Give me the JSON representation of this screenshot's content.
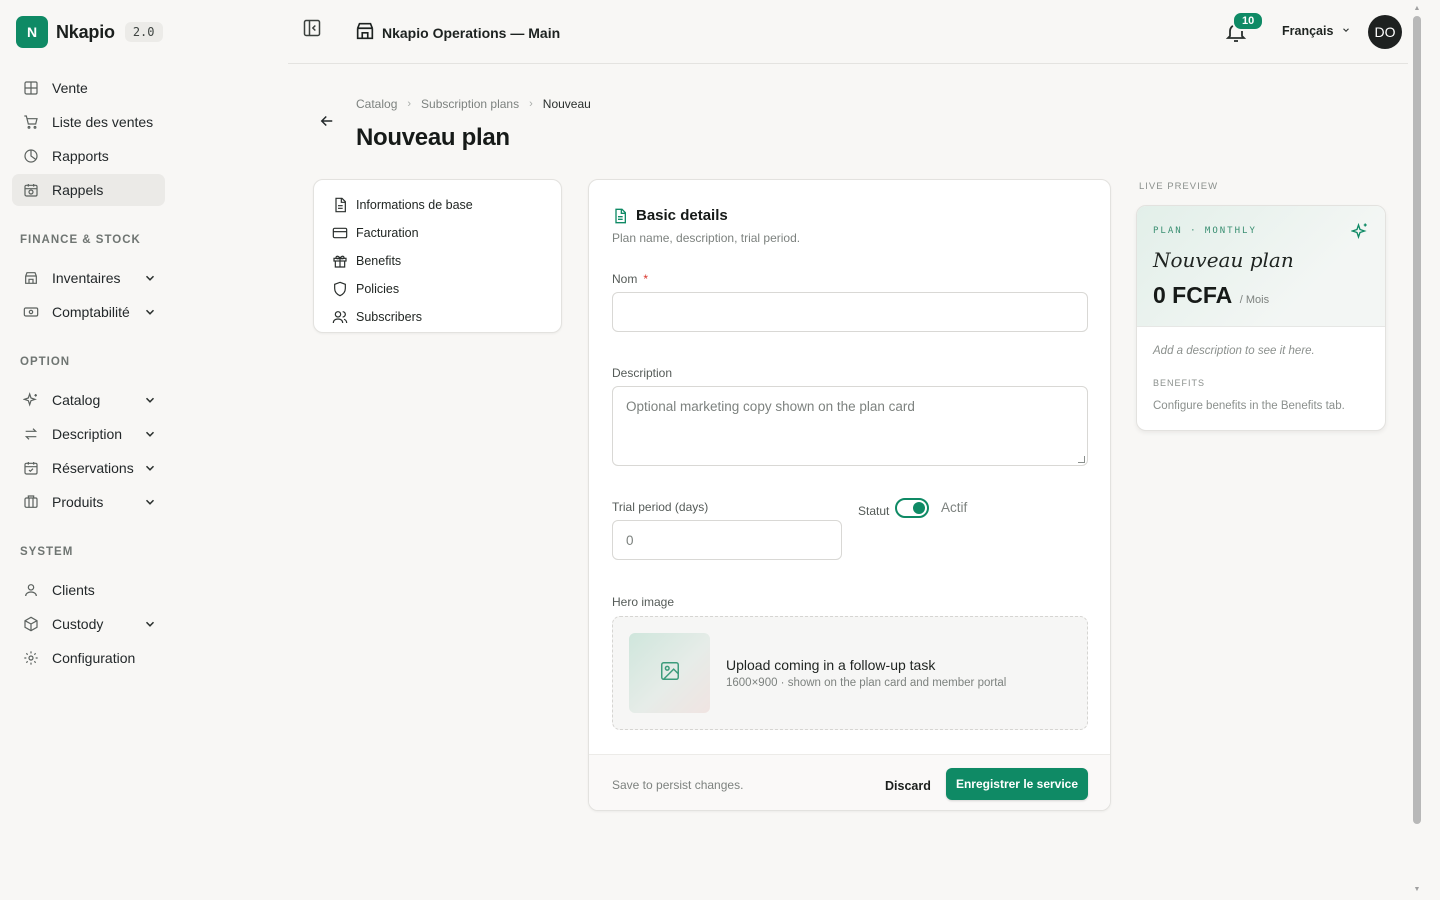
{
  "brand": {
    "logo_letter": "N",
    "name": "Nkapio",
    "version": "2.0"
  },
  "sidebar": {
    "items": [
      {
        "label": "Vente",
        "icon": "grid-icon"
      },
      {
        "label": "Liste des ventes",
        "icon": "cart-icon"
      },
      {
        "label": "Rapports",
        "icon": "pie-chart-icon"
      },
      {
        "label": "Rappels",
        "icon": "calendar-clock-icon",
        "active": true
      }
    ],
    "sections": [
      {
        "title": "FINANCE & STOCK",
        "items": [
          {
            "label": "Inventaires",
            "icon": "store-icon",
            "expandable": true
          },
          {
            "label": "Comptabilité",
            "icon": "banknote-icon",
            "expandable": true
          }
        ]
      },
      {
        "title": "OPTION",
        "items": [
          {
            "label": "Catalog",
            "icon": "sparkles-icon",
            "expandable": true
          },
          {
            "label": "Description",
            "icon": "arrows-swap-icon",
            "expandable": true
          },
          {
            "label": "Réservations",
            "icon": "calendar-check-icon",
            "expandable": true
          },
          {
            "label": "Produits",
            "icon": "columns-icon",
            "expandable": true
          }
        ]
      },
      {
        "title": "SYSTEM",
        "items": [
          {
            "label": "Clients",
            "icon": "user-icon"
          },
          {
            "label": "Custody",
            "icon": "package-icon",
            "expandable": true
          },
          {
            "label": "Configuration",
            "icon": "gear-icon"
          }
        ]
      }
    ]
  },
  "topbar": {
    "store_name": "Nkapio Operations — Main",
    "notification_count": "10",
    "language": "Français",
    "avatar_initials": "DO"
  },
  "breadcrumb": [
    "Catalog",
    "Subscription plans",
    "Nouveau"
  ],
  "page_title": "Nouveau plan",
  "section_menu": [
    {
      "label": "Informations de base",
      "icon": "file-text-icon"
    },
    {
      "label": "Facturation",
      "icon": "credit-card-icon"
    },
    {
      "label": "Benefits",
      "icon": "gift-icon"
    },
    {
      "label": "Policies",
      "icon": "shield-icon"
    },
    {
      "label": "Subscribers",
      "icon": "users-icon"
    }
  ],
  "form": {
    "heading": "Basic details",
    "subheading": "Plan name, description, trial period.",
    "name_label": "Nom",
    "name_required": "*",
    "name_value": "",
    "description_label": "Description",
    "description_placeholder": "Optional marketing copy shown on the plan card",
    "trial_label": "Trial period (days)",
    "trial_value": "0",
    "status_label": "Statut",
    "status_value": "Actif",
    "status_on": true,
    "hero_label": "Hero image",
    "upload_title": "Upload coming in a follow-up task",
    "upload_sub": "1600×900 · shown on the plan card and member portal",
    "footer_hint": "Save to persist changes.",
    "discard_label": "Discard",
    "save_label": "Enregistrer le service"
  },
  "preview": {
    "label": "LIVE PREVIEW",
    "kicker": "PLAN · MONTHLY",
    "plan_name": "Nouveau plan",
    "price": "0 FCFA",
    "period": "/ Mois",
    "description_placeholder": "Add a description to see it here.",
    "benefits_heading": "BENEFITS",
    "benefits_placeholder": "Configure benefits in the Benefits tab."
  },
  "colors": {
    "accent": "#0f8a65",
    "background": "#f8f7f5",
    "surface": "#ffffff"
  }
}
